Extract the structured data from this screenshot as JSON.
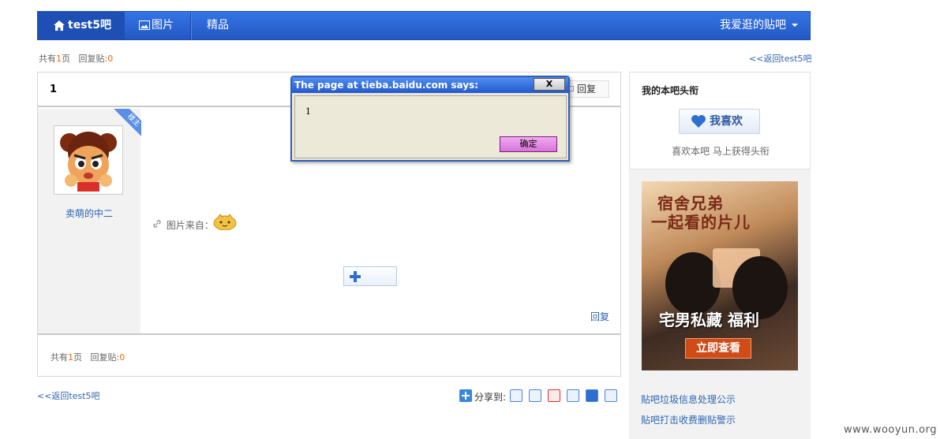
{
  "topnav": {
    "home_label": "test5吧",
    "pictures_label": "图片",
    "featured_label": "精品",
    "my_bars_label": "我爱逛的贴吧"
  },
  "thread_meta": {
    "total_prefix": "共有",
    "pages": "1",
    "pages_suffix": "页",
    "replies_label": "回复贴:",
    "replies": "0"
  },
  "back_link": "<<返回test5吧",
  "post": {
    "title": "1",
    "reply_button": "回复",
    "author_badge": "楼主",
    "author_name": "卖萌的中二",
    "image_source_label": "图片来自：",
    "reply_link": "回复"
  },
  "sidebar": {
    "title": "我的本吧头衔",
    "like_button": "我喜欢",
    "like_tip": "喜欢本吧  马上获得头衔",
    "ad": {
      "line1": "宿舍兄弟",
      "line2": "一起看的片儿",
      "line3": "宅男私藏 福利",
      "cta": "立即查看"
    },
    "links": [
      "贴吧垃圾信息处理公示",
      "贴吧打击收费删贴警示"
    ]
  },
  "share": {
    "label": "分享到:"
  },
  "dialog": {
    "title": "The page at tieba.baidu.com says:",
    "close": "X",
    "message": "1",
    "ok": "确定"
  },
  "watermark": "www.wooyun.org",
  "colors": {
    "nav": "#2b66d6",
    "link": "#2d64b3",
    "count": "#ff6600"
  }
}
